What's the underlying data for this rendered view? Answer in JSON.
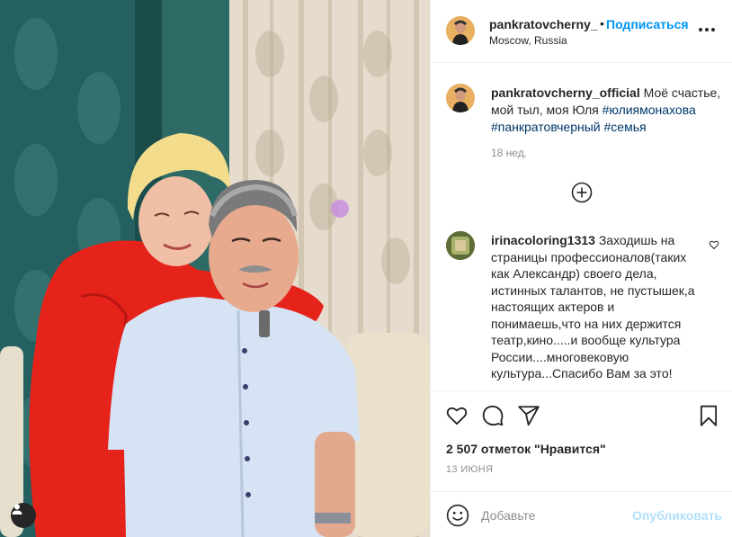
{
  "photo": {
    "user_tag_icon": "user-silhouette-icon"
  },
  "header": {
    "username": "pankratovcherny_",
    "dot": "•",
    "follow_label": "Подписаться",
    "location": "Moscow, Russia",
    "more_icon": "more-horizontal-icon"
  },
  "caption": {
    "username": "pankratovcherny_official",
    "text": "Моё счастье, мой тыл, моя Юля",
    "hashtags": [
      "#юлиямонахова",
      "#панкратовчерный",
      "#семья"
    ],
    "time": "18 нед."
  },
  "load_more_icon": "plus-circle-icon",
  "comment": {
    "username": "irinacoloring1313",
    "text": "Заходишь на страницы профессионалов(таких как Александр) своего дела, истинных талантов, не пустышек,а настоящих актеров и понимаешь,что на них держится театр,кино.....и вообще культура России....многовековую культура...Спасибо Вам за это!"
  },
  "actions": {
    "like_icon": "heart-icon",
    "comment_icon": "comment-icon",
    "share_icon": "paper-plane-icon",
    "save_icon": "bookmark-icon",
    "likes": "2 507 отметок \"Нравится\"",
    "date": "13 ИЮНЯ"
  },
  "add_comment": {
    "emoji_icon": "smiley-icon",
    "placeholder": "Добавьте",
    "publish_label": "Опубликовать"
  },
  "colors": {
    "link_blue": "#0095f6",
    "publish_disabled": "#b2dffc",
    "hashtag": "#00376b",
    "muted": "#8e8e8e"
  }
}
